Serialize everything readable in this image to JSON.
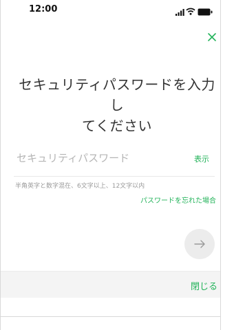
{
  "status_bar": {
    "time": "12:00"
  },
  "dialog": {
    "title_line1": "セキュリティパスワードを入力し",
    "title_line2": "てください",
    "password_placeholder": "セキュリティパスワード",
    "show_label": "表示",
    "hint": "半角英字と数字混在、6文字以上、12文字以内",
    "forgot_link": "パスワードを忘れた場合"
  },
  "footer": {
    "close_label": "閉じる"
  },
  "colors": {
    "accent": "#23b35a",
    "next_button_bg": "#ececec",
    "footer_bg": "#f4f4f4"
  }
}
